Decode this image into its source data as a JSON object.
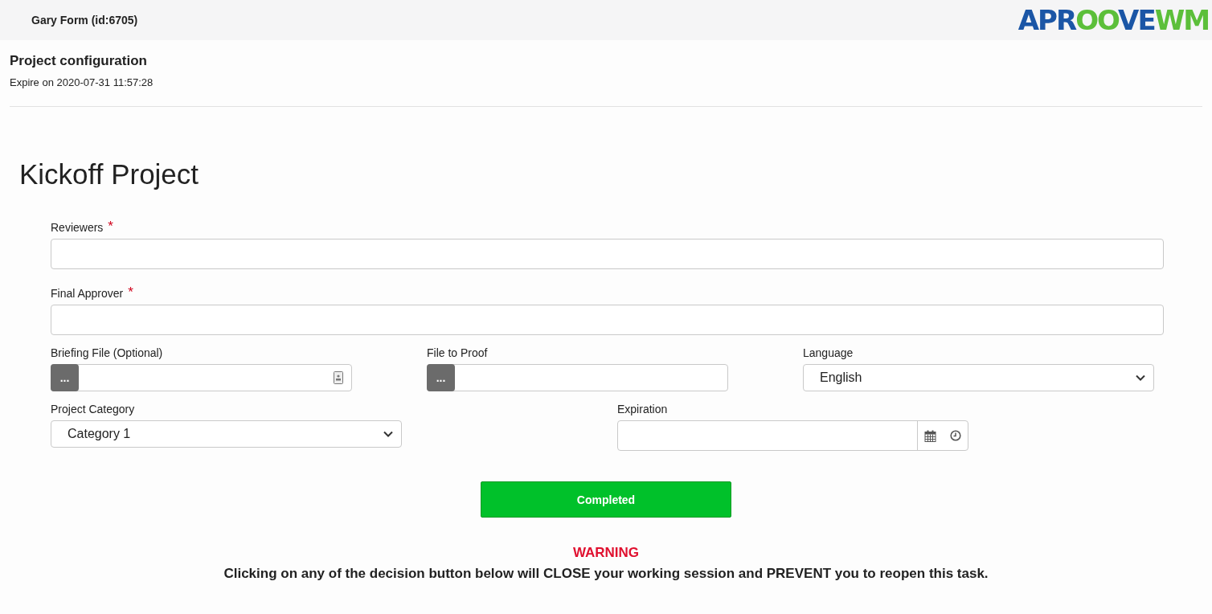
{
  "header": {
    "title": "Gary Form (id:6705)",
    "logo": [
      {
        "text": "APR",
        "color": "#1b56a6"
      },
      {
        "text": "OO",
        "color": "#5cbf3a"
      },
      {
        "text": "VE",
        "color": "#1b56a6"
      },
      {
        "text": "WM",
        "color": "#5cbf3a"
      }
    ]
  },
  "section": {
    "title": "Project configuration",
    "expire": "Expire on 2020-07-31 11:57:28"
  },
  "form": {
    "title": "Kickoff Project",
    "rows": [
      [
        {
          "kind": "text",
          "label": "Reviewers",
          "required_mark": "*"
        }
      ],
      [
        {
          "kind": "text",
          "label": "Final Approver",
          "required_mark": "*"
        }
      ],
      [
        {
          "kind": "file",
          "label": "Briefing File (Optional)",
          "button": "...",
          "attach_icon": true
        },
        {
          "kind": "file",
          "label": "File to Proof",
          "button": "..."
        },
        {
          "kind": "select",
          "label": "Language",
          "value": "English"
        }
      ],
      [
        {
          "kind": "select",
          "label": "Project Category",
          "value": "Category 1"
        },
        {
          "kind": "datetime",
          "label": "Expiration"
        }
      ]
    ],
    "submit": "Completed",
    "warning": "WARNING",
    "notice": "Clicking on any of the decision button below will CLOSE your working session and PREVENT you to reopen this task."
  }
}
